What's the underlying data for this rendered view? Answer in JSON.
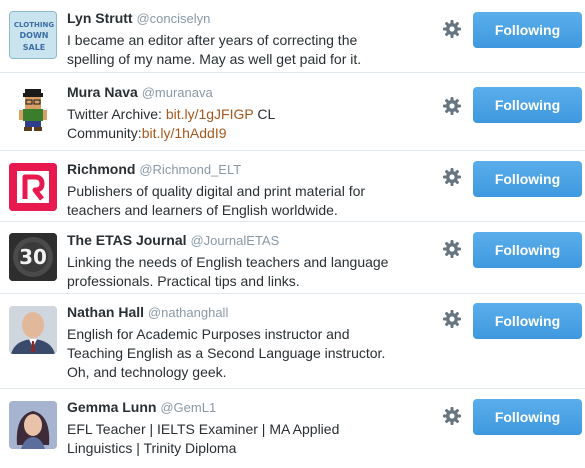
{
  "users": [
    {
      "name": "Lyn Strutt",
      "handle": "@conciselyn",
      "bio": [
        "I became an editor after years of correcting the",
        "spelling of my name. May as well get paid for it."
      ],
      "avatar_text": "CLOTHING DOWN SALE",
      "follow_label": "Following"
    },
    {
      "name": "Mura Nava",
      "handle": "@muranava",
      "bio_line1_prefix": "Twitter Archive: ",
      "bio_link1": "bit.ly/1gJFIGP",
      "bio_line1_suffix": " CL",
      "bio_line2_prefix": "Community:",
      "bio_link2": "bit.ly/1hAddI9",
      "follow_label": "Following"
    },
    {
      "name": "Richmond",
      "handle": "@Richmond_ELT",
      "bio": [
        "Publishers of quality digital and print material for",
        "teachers and learners of English worldwide."
      ],
      "follow_label": "Following"
    },
    {
      "name": "The ETAS Journal",
      "handle": "@JournalETAS",
      "bio": [
        "Linking the needs of English teachers and language",
        "professionals. Practical tips and links."
      ],
      "avatar_text": "30",
      "follow_label": "Following"
    },
    {
      "name": "Nathan Hall",
      "handle": "@nathanghall",
      "bio": [
        "English for Academic Purposes instructor and",
        "Teaching English as a Second Language instructor.",
        "Oh, and technology geek."
      ],
      "follow_label": "Following"
    },
    {
      "name": "Gemma Lunn",
      "handle": "@GemL1",
      "bio": [
        "EFL Teacher | IELTS Examiner | MA Applied",
        "Linguistics | Trinity Diploma"
      ],
      "follow_label": "Following"
    }
  ],
  "colors": {
    "button": "#4a9fe3",
    "link": "#a4581e",
    "handle": "#8899a6",
    "divider": "#e1e8ed"
  },
  "icons": {
    "settings": "gear-icon"
  }
}
